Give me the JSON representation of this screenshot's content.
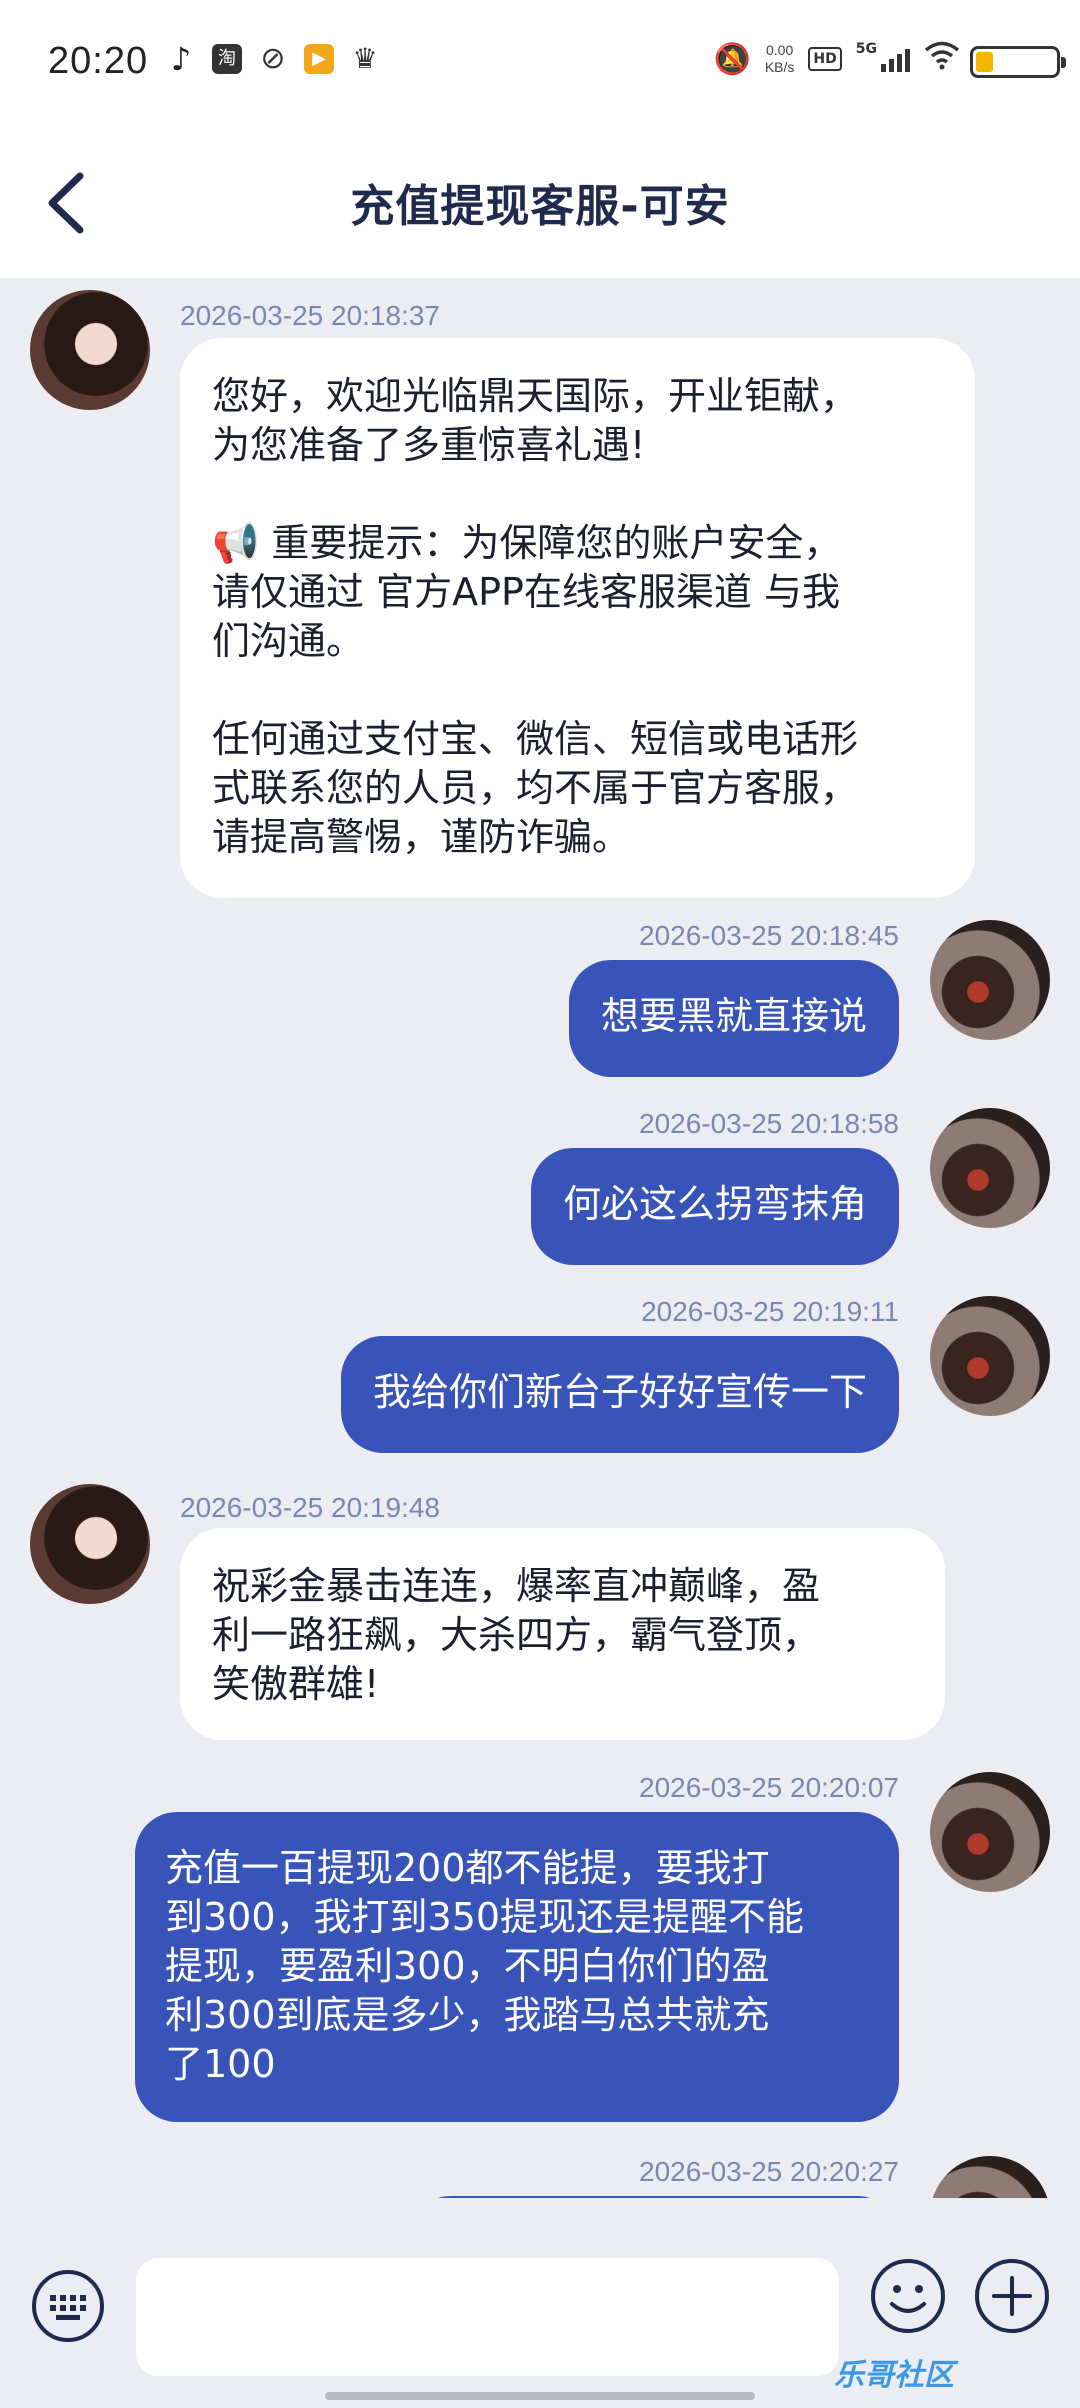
{
  "status_bar": {
    "time": "20:20",
    "apps": [
      "tiktok-icon",
      "taobao-icon",
      "app-icon",
      "video-icon",
      "crown-icon"
    ],
    "taobao_label": "淘",
    "net_speed_value": "0.00",
    "net_speed_unit": "KB/s",
    "hd_label": "HD",
    "network_label": "5G",
    "battery_color": "#f6b500"
  },
  "header": {
    "title": "充值提现客服-可安"
  },
  "messages": [
    {
      "side": "in",
      "time": "2026-03-25 20:18:37",
      "text": "您好，欢迎光临鼎天国际，开业钜献，\n为您准备了多重惊喜礼遇!\n\n📢 重要提示：为保障您的账户安全，\n请仅通过 官方APP在线客服渠道 与我\n们沟通。\n\n任何通过支付宝、微信、短信或电话形\n式联系您的人员，均不属于官方客服，\n请提高警惕，谨防诈骗。"
    },
    {
      "side": "out",
      "time": "2026-03-25 20:18:45",
      "text": "想要黑就直接说"
    },
    {
      "side": "out",
      "time": "2026-03-25 20:18:58",
      "text": "何必这么拐弯抹角"
    },
    {
      "side": "out",
      "time": "2026-03-25 20:19:11",
      "text": "我给你们新台子好好宣传一下"
    },
    {
      "side": "in",
      "time": "2026-03-25 20:19:48",
      "text": "祝彩金暴击连连，爆率直冲巅峰，盈\n利一路狂飙，大杀四方，霸气登顶，\n笑傲群雄!"
    },
    {
      "side": "out",
      "time": "2026-03-25 20:20:07",
      "text": "充值一百提现200都不能提，要我打\n到300，我打到350提现还是提醒不能\n提现，要盈利300，不明白你们的盈\n利300到底是多少，我踏马总共就充\n了100"
    },
    {
      "side": "out",
      "time": "2026-03-25 20:20:27",
      "text": ""
    }
  ],
  "input": {
    "placeholder": ""
  },
  "watermark": "乐哥社区",
  "colors": {
    "accent": "#3954b8",
    "background": "#ececf3",
    "timestamp": "#7a88b0",
    "title": "#1f2a4d"
  }
}
